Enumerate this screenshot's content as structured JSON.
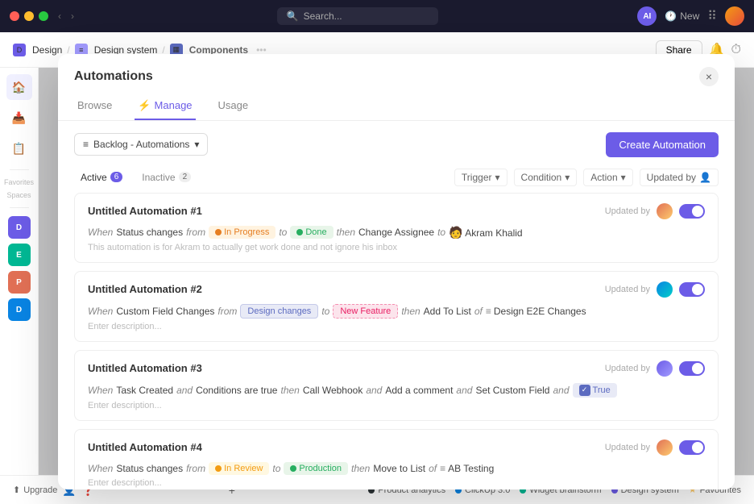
{
  "topbar": {
    "search_placeholder": "Search...",
    "ai_label": "AI",
    "new_label": "New"
  },
  "breadcrumb": {
    "design": "Design",
    "system": "Design system",
    "components": "Components",
    "share": "Share"
  },
  "modal": {
    "title": "Automations",
    "tabs": [
      {
        "label": "Browse",
        "active": false
      },
      {
        "label": "Manage",
        "active": true
      },
      {
        "label": "Usage",
        "active": false
      }
    ],
    "close_icon": "×",
    "backlog_label": "Backlog -  Automations",
    "create_btn": "Create Automation",
    "filter_active_label": "Active",
    "filter_active_count": "6",
    "filter_inactive_label": "Inactive",
    "filter_inactive_count": "2",
    "trigger_label": "Trigger",
    "condition_label": "Condition",
    "action_label": "Action",
    "updated_label": "Updated by",
    "automations": [
      {
        "id": 1,
        "name": "Untitled Automation #1",
        "enabled": true,
        "when": "When",
        "trigger": "Status changes",
        "from_label": "from",
        "from_value": "In Progress",
        "from_type": "inprogress",
        "to_label": "to",
        "to_value": "Done",
        "to_type": "done",
        "then_label": "then",
        "action": "Change Assignee",
        "action_to_label": "to",
        "action_target": "Akram Khalid",
        "description": "This automation is for Akram to actually get work done and not ignore his inbox",
        "updated_by_label": "Updated by",
        "avatar_type": "orange"
      },
      {
        "id": 2,
        "name": "Untitled Automation #2",
        "enabled": true,
        "when": "When",
        "trigger": "Custom Field Changes",
        "from_label": "from",
        "from_value": "Design changes",
        "from_type": "design",
        "to_label": "to",
        "to_value": "New Feature",
        "to_type": "feature",
        "then_label": "then",
        "action": "Add To List",
        "action_of_label": "of",
        "action_target": "Design E2E Changes",
        "description": "Enter description...",
        "updated_by_label": "Updated by",
        "avatar_type": "blue"
      },
      {
        "id": 3,
        "name": "Untitled Automation #3",
        "enabled": true,
        "when": "When",
        "trigger": "Task Created",
        "and_label1": "and",
        "condition": "Conditions are true",
        "then_label": "then",
        "action1": "Call Webhook",
        "and_label2": "and",
        "action2": "Add a comment",
        "and_label3": "and",
        "action3": "Set Custom Field",
        "and_label4": "and",
        "action3_value": "True",
        "description": "Enter description...",
        "updated_by_label": "Updated by",
        "avatar_type": "purple"
      },
      {
        "id": 4,
        "name": "Untitled Automation #4",
        "enabled": true,
        "when": "When",
        "trigger": "Status changes",
        "from_label": "from",
        "from_value": "In Review",
        "from_type": "inreview",
        "to_label": "to",
        "to_value": "Production",
        "to_type": "production",
        "then_label": "then",
        "action": "Move to List",
        "action_of_label": "of",
        "action_target": "AB Testing",
        "description": "Enter description...",
        "updated_by_label": "Updated by",
        "avatar_type": "orange2"
      }
    ]
  },
  "sidebar": {
    "icons": [
      "🏠",
      "📥",
      "📋"
    ],
    "spaces": [
      {
        "label": "D",
        "type": "sp-d"
      },
      {
        "label": "E",
        "type": "sp-e"
      },
      {
        "label": "P",
        "type": "sp-p"
      },
      {
        "label": "D",
        "type": "sp-da"
      }
    ]
  },
  "bottombar": {
    "upgrade": "Upgrade",
    "items": [
      {
        "label": "Product analytics",
        "dot": "dot-dark"
      },
      {
        "label": "ClickUp 3.0",
        "dot": "dot-blue"
      },
      {
        "label": "Widget brainstorm",
        "dot": "dot-teal"
      },
      {
        "label": "Design system",
        "dot": "dot-purple"
      },
      {
        "label": "Favourites",
        "dot": "dot-yellow2"
      }
    ]
  }
}
